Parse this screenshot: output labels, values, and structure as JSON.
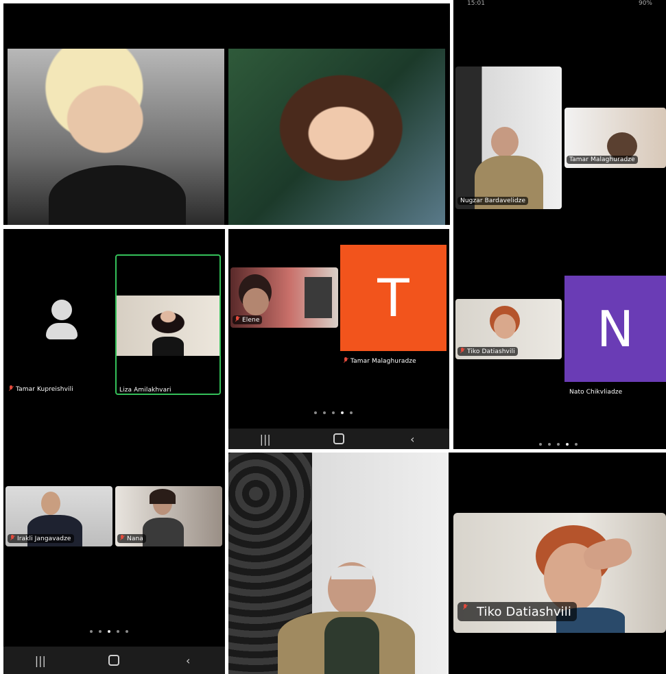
{
  "collage": {
    "screenshots": [
      {
        "participants": {
          "presenter_a": "",
          "presenter_b": ""
        }
      },
      {
        "participants": [
          "Tamar Kupreishvili",
          "Liza Amilakhvari",
          "Irakli Jangavadze",
          "Nana"
        ],
        "page_indicator": {
          "count": 5,
          "active": 3
        }
      },
      {
        "participants": [
          "Elene",
          "Tamar Malaghuradze"
        ],
        "avatar_letter": "T",
        "avatar_color": "#f2541c",
        "page_indicator": {
          "count": 5,
          "active": 4
        }
      },
      {
        "status_bar": {
          "time": "15:01",
          "battery": "90%"
        },
        "participants": [
          "Nugzar Bardavelidze",
          "Tamar Malaghuradze",
          "Tiko Datiashvili",
          "Nato Chikvliadze"
        ],
        "avatar_letter": "N",
        "avatar_color": "#6a3cb5",
        "page_indicator": {
          "count": 5,
          "active": 4
        }
      },
      {
        "participants": [
          "Tiko Datiashvili"
        ]
      }
    ],
    "navbar": {
      "recents": "|||",
      "back": "‹"
    },
    "colors": {
      "active_speaker_border": "#35c15a",
      "muted_mic": "#e14a3c",
      "panel_bg": "#000000"
    }
  }
}
